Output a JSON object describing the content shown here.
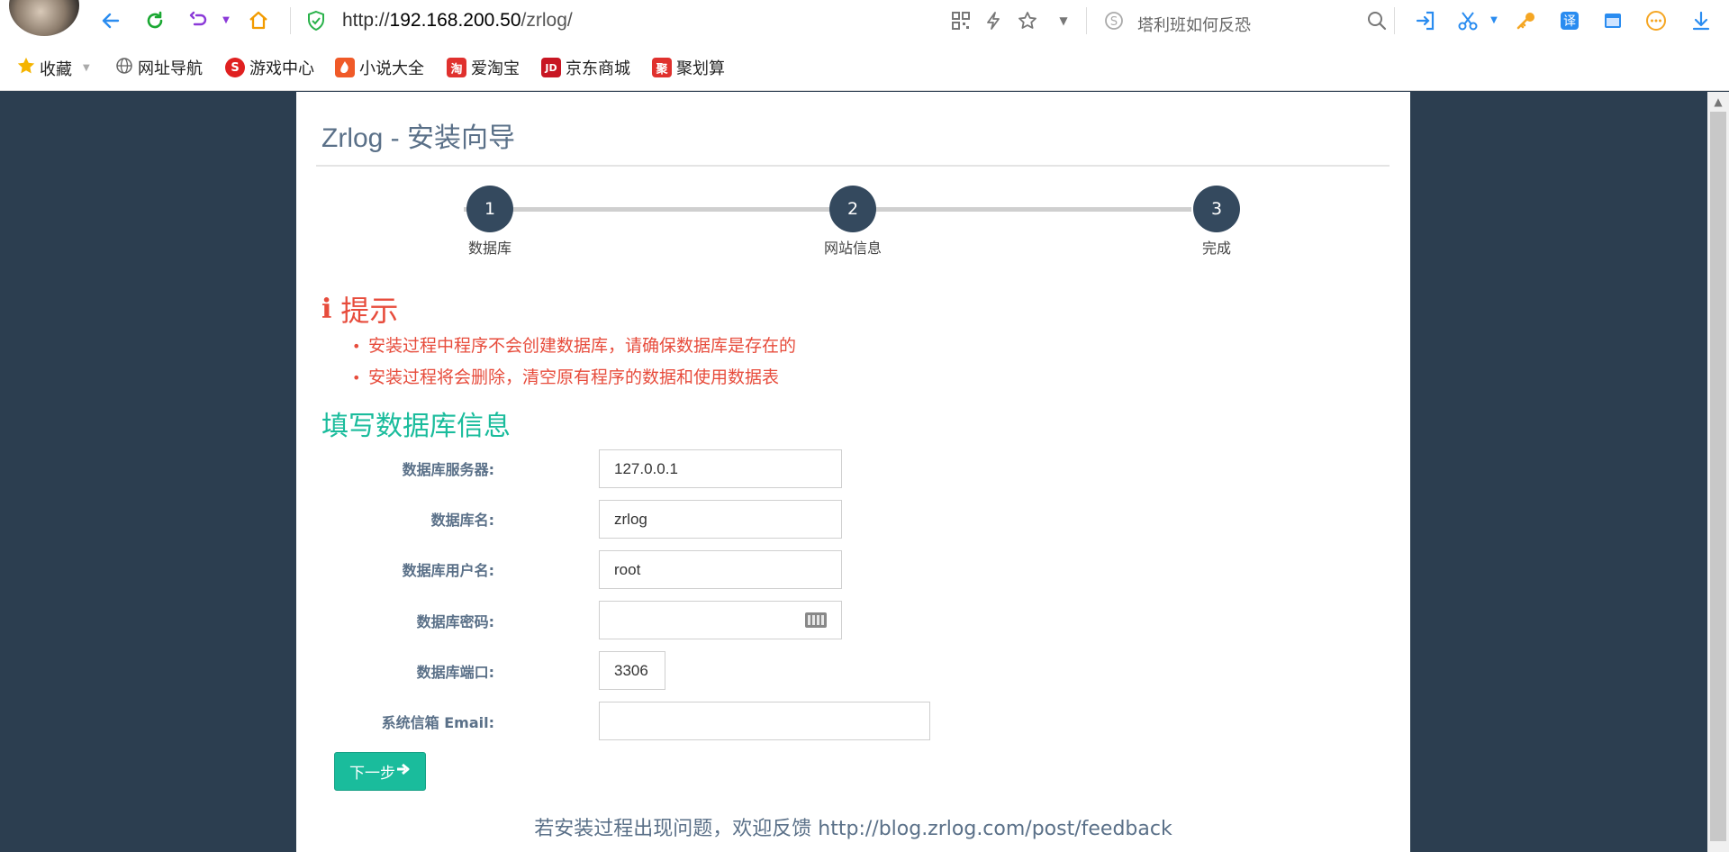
{
  "browser": {
    "url_scheme": "http://",
    "url_host": "192.168.200.50",
    "url_path": "/zrlog/",
    "search_placeholder": "塔利班如何反恐"
  },
  "bookmarks": [
    {
      "label": "收藏",
      "icon": "star-icon",
      "color": "#f5b400"
    },
    {
      "label": "网址导航",
      "icon": "globe-icon",
      "color": "#666666"
    },
    {
      "label": "游戏中心",
      "icon": "game-icon",
      "color": "#e02020"
    },
    {
      "label": "小说大全",
      "icon": "novel-icon",
      "color": "#f05a28"
    },
    {
      "label": "爱淘宝",
      "icon": "taobao-icon",
      "color": "#e0312e"
    },
    {
      "label": "京东商城",
      "icon": "jd-icon",
      "color": "#c81623"
    },
    {
      "label": "聚划算",
      "icon": "juhuasuan-icon",
      "color": "#e0312e"
    }
  ],
  "bookmark_glyphs": {
    "taobao": "淘",
    "jd": "JD",
    "juhuasuan": "聚",
    "game": "S"
  },
  "page": {
    "title": "Zrlog - 安装向导",
    "steps": [
      {
        "number": "1",
        "label": "数据库"
      },
      {
        "number": "2",
        "label": "网站信息"
      },
      {
        "number": "3",
        "label": "完成"
      }
    ],
    "tip_heading": "提示",
    "tips": [
      "安装过程中程序不会创建数据库，请确保数据库是存在的",
      "安装过程将会删除，清空原有程序的数据和使用数据表"
    ],
    "section_heading": "填写数据库信息",
    "form": {
      "db_host_label": "数据库服务器:",
      "db_host_value": "127.0.0.1",
      "db_name_label": "数据库名:",
      "db_name_value": "zrlog",
      "db_user_label": "数据库用户名:",
      "db_user_value": "root",
      "db_password_label": "数据库密码:",
      "db_password_value": "",
      "db_port_label": "数据库端口:",
      "db_port_value": "3306",
      "email_label": "系统信箱 Email:",
      "email_value": ""
    },
    "next_button": "下一步",
    "footer_text": "若安装过程出现问题，欢迎反馈 http://blog.zrlog.com/post/feedback"
  },
  "colors": {
    "background": "#2c3e50",
    "step_circle": "#34495e",
    "accent": "#1abc9c",
    "warning": "#e74c3c"
  }
}
